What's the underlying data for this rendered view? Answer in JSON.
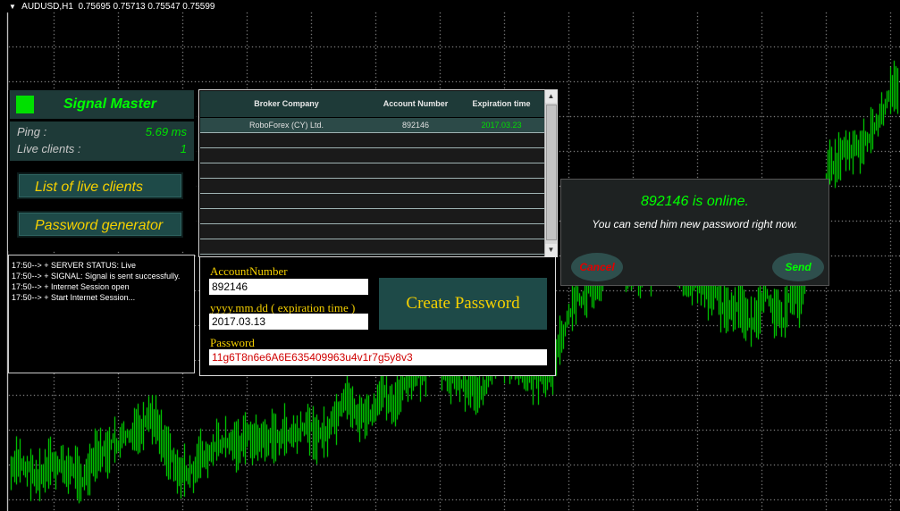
{
  "header": {
    "symbol": "AUDUSD,H1",
    "ohlc": "0.75695 0.75713 0.75547 0.75599"
  },
  "signal_master": {
    "title": "Signal Master",
    "ping_label": "Ping :",
    "ping_value": "5.69 ms",
    "clients_label": "Live clients :",
    "clients_value": "1",
    "btn_live_clients": "List of live clients",
    "btn_password_gen": "Password generator"
  },
  "log": [
    "17:50--> + SERVER STATUS: Live",
    "17:50--> + SIGNAL: Signal is sent successfully.",
    "17:50--> + Internet Session open",
    "17:50--> + Start Internet Session..."
  ],
  "table": {
    "headers": [
      "Broker Company",
      "Account Number",
      "Expiration time"
    ],
    "row": {
      "broker": "RoboForex (CY) Ltd.",
      "account": "892146",
      "expiration": "2017.03.23"
    }
  },
  "form": {
    "account_label": "AccountNumber",
    "account_value": "892146",
    "expiry_label": "yyyy.mm.dd  ( expiration time )",
    "expiry_value": "2017.03.13",
    "password_label": "Password",
    "password_value": "11g6T8n6e6A6E635409963u4v1r7g5y8v3",
    "create_button": "Create Password"
  },
  "dialog": {
    "title": "892146 is online.",
    "message": "You can send him new password right now.",
    "cancel": "Cancel",
    "send": "Send"
  },
  "colors": {
    "bull_candle": "#00ff00",
    "grid": "#d0d0d0",
    "accent_text": "#f5d000"
  }
}
